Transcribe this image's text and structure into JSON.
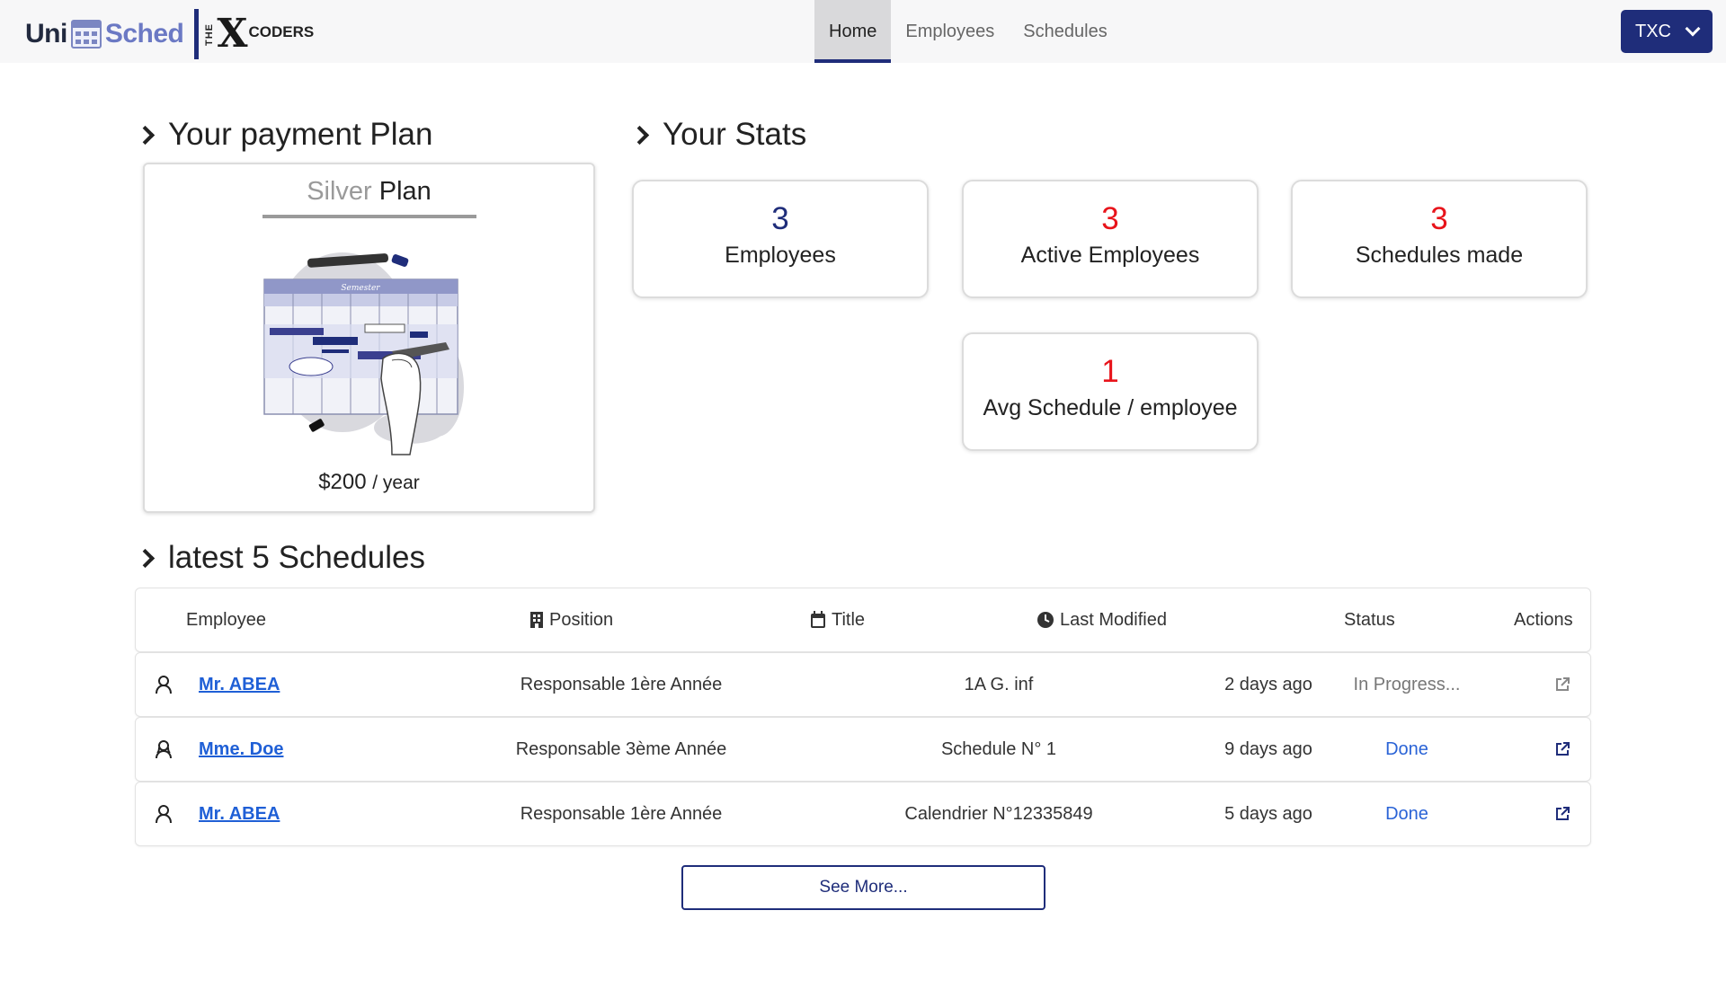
{
  "brand": {
    "uni": "Uni",
    "sched": "Sched",
    "the": "THE",
    "x": "X",
    "coders": "CODERS"
  },
  "nav": {
    "items": [
      {
        "label": "Home",
        "active": true
      },
      {
        "label": "Employees",
        "active": false
      },
      {
        "label": "Schedules",
        "active": false
      }
    ]
  },
  "account": {
    "label": "TXC"
  },
  "plan": {
    "heading": "Your payment Plan",
    "tier": "Silver",
    "plan_word": "Plan",
    "price": "$200",
    "period": "/ year",
    "illustration_text": "Semester"
  },
  "stats": {
    "heading": "Your Stats",
    "cards": [
      {
        "value": "3",
        "label": "Employees",
        "color": "#1f2d7a"
      },
      {
        "value": "3",
        "label": "Active Employees",
        "color": "#e8141b"
      },
      {
        "value": "3",
        "label": "Schedules made",
        "color": "#e8141b"
      },
      {
        "value": "1",
        "label": "Avg Schedule / employee",
        "color": "#e8141b"
      }
    ]
  },
  "schedules": {
    "heading": "latest 5 Schedules",
    "columns": {
      "employee": "Employee",
      "position": "Position",
      "title": "Title",
      "last_modified": "Last Modified",
      "status": "Status",
      "actions": "Actions"
    },
    "rows": [
      {
        "employee": "Mr. ABEA",
        "position": "Responsable 1ère Année",
        "title": "1A G. inf",
        "modified": "2 days ago",
        "status": "In Progress...",
        "state": "progress"
      },
      {
        "employee": "Mme. Doe",
        "position": "Responsable 3ème Année",
        "title": "Schedule N° 1",
        "modified": "9 days ago",
        "status": "Done",
        "state": "done"
      },
      {
        "employee": "Mr. ABEA",
        "position": "Responsable 1ère Année",
        "title": "Calendrier N°12335849",
        "modified": "5 days ago",
        "status": "Done",
        "state": "done"
      }
    ],
    "see_more": "See More..."
  }
}
